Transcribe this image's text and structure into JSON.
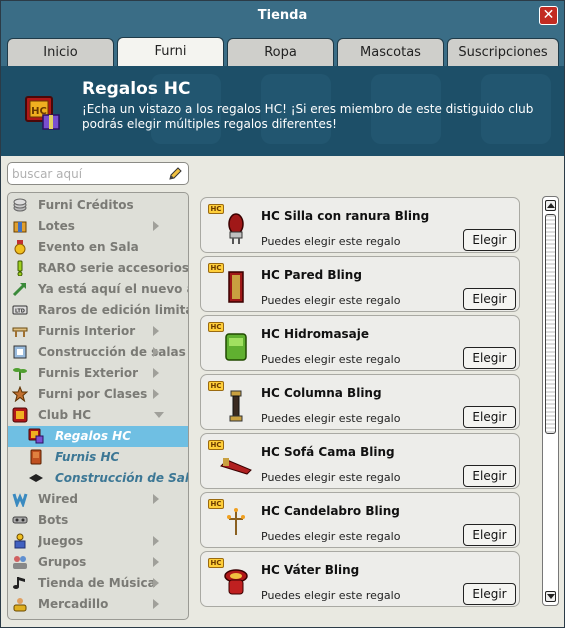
{
  "window": {
    "title": "Tienda"
  },
  "tabs": [
    {
      "label": "Inicio"
    },
    {
      "label": "Furni"
    },
    {
      "label": "Ropa"
    },
    {
      "label": "Mascotas"
    },
    {
      "label": "Suscripciones"
    }
  ],
  "active_tab": "Furni",
  "banner": {
    "title": "Regalos HC",
    "description": "¡Echa un vistazo a los regalos HC! ¡Si eres miembro de este distiguido club podrás elegir múltiples regalos diferentes!",
    "icon": "hc-gift-icon"
  },
  "search": {
    "placeholder": "buscar aquí",
    "value": ""
  },
  "sidebar": {
    "items": [
      {
        "label": "Furni Créditos",
        "icon": "coins-icon"
      },
      {
        "label": "Lotes",
        "icon": "box-icon"
      },
      {
        "label": "Evento en Sala",
        "icon": "medal-icon"
      },
      {
        "label": "RARO serie accesorios dorados",
        "icon": "exclamation-icon"
      },
      {
        "label": "Ya está aquí el nuevo año",
        "icon": "arrow-icon"
      },
      {
        "label": "Raros de edición limitada",
        "icon": "ltd-icon"
      },
      {
        "label": "Furnis Interior",
        "icon": "table-icon"
      },
      {
        "label": "Construcción de salas",
        "icon": "frame-icon"
      },
      {
        "label": "Furnis Exterior",
        "icon": "plant-icon"
      },
      {
        "label": "Furni por Clases",
        "icon": "star-icon"
      },
      {
        "label": "Club HC",
        "icon": "hc-icon"
      },
      {
        "label": "Regalos HC",
        "icon": "hc-gift-icon"
      },
      {
        "label": "Furnis HC",
        "icon": "hc-chair-icon"
      },
      {
        "label": "Construcción de Sala",
        "icon": "diamond-icon"
      },
      {
        "label": "Wired",
        "icon": "wired-icon"
      },
      {
        "label": "Bots",
        "icon": "bot-icon"
      },
      {
        "label": "Juegos",
        "icon": "game-icon"
      },
      {
        "label": "Grupos",
        "icon": "group-icon"
      },
      {
        "label": "Tienda de Música",
        "icon": "music-icon"
      },
      {
        "label": "Mercadillo",
        "icon": "market-icon"
      }
    ]
  },
  "products": [
    {
      "name": "HC Silla con ranura Bling",
      "note": "Puedes elegir este regalo",
      "button": "Elegir",
      "badge": "HC"
    },
    {
      "name": "HC Pared Bling",
      "note": "Puedes elegir este regalo",
      "button": "Elegir",
      "badge": "HC"
    },
    {
      "name": "HC Hidromasaje",
      "note": "Puedes elegir este regalo",
      "button": "Elegir",
      "badge": "HC"
    },
    {
      "name": "HC Columna Bling",
      "note": "Puedes elegir este regalo",
      "button": "Elegir",
      "badge": "HC"
    },
    {
      "name": "HC Sofá Cama Bling",
      "note": "Puedes elegir este regalo",
      "button": "Elegir",
      "badge": "HC"
    },
    {
      "name": "HC Candelabro Bling",
      "note": "Puedes elegir este regalo",
      "button": "Elegir",
      "badge": "HC"
    },
    {
      "name": "HC Váter Bling",
      "note": "Puedes elegir este regalo",
      "button": "Elegir",
      "badge": "HC"
    }
  ],
  "colors": {
    "titlebar": "#3a6d86",
    "banner": "#1d4f68",
    "selected": "#6fbfe3",
    "close": "#c22b22"
  }
}
